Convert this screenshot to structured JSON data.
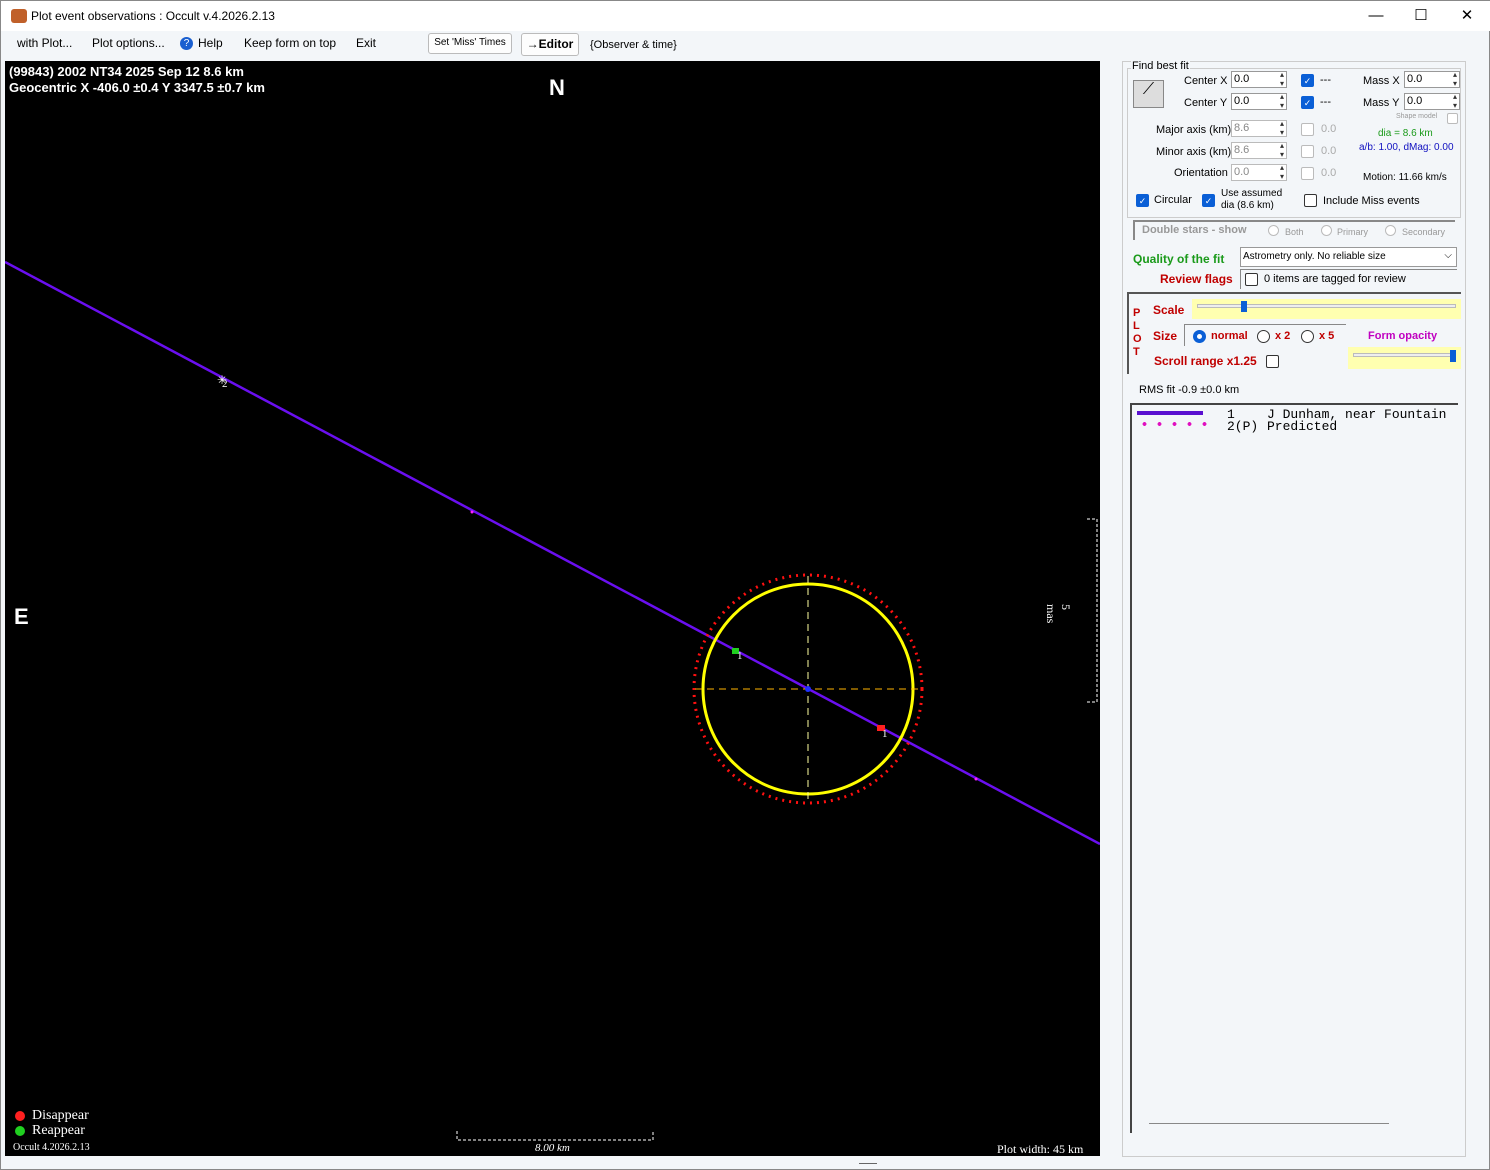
{
  "window": {
    "title": "Plot event observations : Occult v.4.2026.2.13",
    "minimize": "—",
    "maximize": "☐",
    "close": "✕"
  },
  "menu": {
    "with_plot": "with Plot...",
    "plot_options": "Plot options...",
    "help": "Help",
    "keep_on_top": "Keep form on top",
    "exit": "Exit",
    "set_miss_times": "Set 'Miss' Times",
    "editor": "→Editor",
    "observer_time": "{Observer & time}"
  },
  "plot": {
    "line1": "(99843) 2002 NT34  2025 Sep 12  8.6 km",
    "line2": "Geocentric X -406.0 ±0.4  Y 3347.5 ±0.7 km",
    "north": "N",
    "east": "E",
    "scale_mas": "5 mas",
    "scale_km": "8.00 km",
    "plot_width": "Plot width: 45 km",
    "version": "Occult 4.2026.2.13",
    "legend": [
      {
        "label": "Disappear",
        "color": "#ff2020"
      },
      {
        "label": "Reappear",
        "color": "#20d020"
      }
    ],
    "chord_labels": [
      "2",
      "1",
      "1"
    ],
    "colors": {
      "chord": "#6a0ff0",
      "outline": "#ffff00",
      "predicted": "#ff1010"
    }
  },
  "fit": {
    "title": "Find best fit",
    "center_x_label": "Center X",
    "center_x": "0.0",
    "center_y_label": "Center Y",
    "center_y": "0.0",
    "dash": "---",
    "mass_x_label": "Mass X",
    "mass_x": "0.0",
    "mass_y_label": "Mass Y",
    "mass_y": "0.0",
    "shape_model": "Shape model",
    "major_label": "Major axis (km)",
    "major": "8.6",
    "minor_label": "Minor axis (km)",
    "minor": "8.6",
    "orient_label": "Orientation",
    "orient": "0.0",
    "zero": "0.0",
    "dia": "dia = 8.6 km",
    "ab": "a/b: 1.00, dMag: 0.00",
    "motion": "Motion: 11.66 km/s",
    "circular": "Circular",
    "use_assumed": "Use assumed dia (8.6 km)",
    "include_miss": "Include Miss events"
  },
  "double": {
    "label": "Double stars - show",
    "both": "Both",
    "primary": "Primary",
    "secondary": "Secondary"
  },
  "quality": {
    "label": "Quality of the fit",
    "value": "Astrometry only. No reliable size"
  },
  "review": {
    "label": "Review flags",
    "text": "0 items are tagged for review"
  },
  "plotctl": {
    "vertical": "P L O T",
    "scale": "Scale",
    "scale_value": 0.18,
    "size": "Size",
    "normal": "normal",
    "x2": "x 2",
    "x5": "x 5",
    "opacity": "Form opacity",
    "opacity_value": 0.97,
    "scroll": "Scroll range x1.25"
  },
  "rms": "RMS fit -0.9 ±0.0 km",
  "observers": [
    {
      "num": "1",
      "name": "J Dunham, near Fountain"
    },
    {
      "num": "2(P)",
      "name": "Predicted"
    }
  ]
}
